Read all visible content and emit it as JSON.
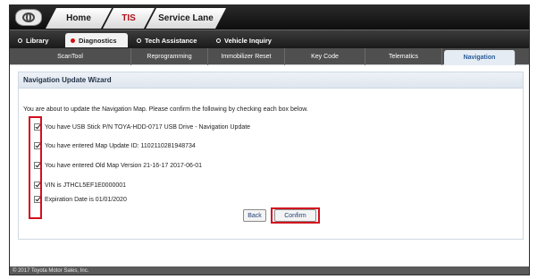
{
  "top_tabs": [
    {
      "label": "Home"
    },
    {
      "label": "TIS"
    },
    {
      "label": "Service Lane"
    }
  ],
  "sub_tabs": [
    {
      "label": "Library"
    },
    {
      "label": "Diagnostics"
    },
    {
      "label": "Tech Assistance"
    },
    {
      "label": "Vehicle Inquiry"
    }
  ],
  "nav_tabs": [
    {
      "label": "ScanTool"
    },
    {
      "label": "Reprogramming"
    },
    {
      "label": "Immobilizer Reset"
    },
    {
      "label": "Key Code"
    },
    {
      "label": "Telematics"
    },
    {
      "label": "Navigation"
    }
  ],
  "panel": {
    "title": "Navigation Update Wizard",
    "intro": "You are about to update the Navigation Map. Please confirm the following by checking each box below.",
    "items": [
      {
        "label": "You have USB Stick P/N  TOYA-HDD-0717  USB Drive - Navigation Update",
        "checked": true
      },
      {
        "label": "You have entered Map Update ID: 1102110281948734",
        "checked": true
      },
      {
        "label": "You have entered Old Map Version  21-16-17 2017-06-01",
        "checked": true
      },
      {
        "label": "VIN is  JTHCL5EF1E0000001",
        "checked": true
      },
      {
        "label": "Expiration Date is 01/01/2020",
        "checked": true
      }
    ],
    "back_label": "Back",
    "confirm_label": "Confirm"
  },
  "footer": {
    "text": "© 2017 Toyota Motor Sales, Inc."
  },
  "colors": {
    "highlight": "#d20f1e",
    "active_tab_text": "#b0101a"
  }
}
